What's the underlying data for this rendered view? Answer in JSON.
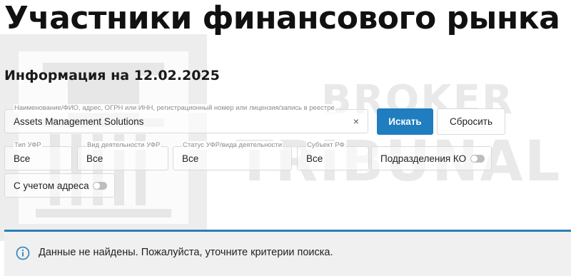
{
  "page_title": "Участники финансового рынка",
  "info_date": "Информация на 12.02.2025",
  "watermark": {
    "line1": "BROKER",
    "line2": "TRIBUNAL"
  },
  "search": {
    "label": "Наименование/ФИО, адрес, ОГРН или ИНН, регистрационный номер или лицензия/запись в реестре",
    "value": "Assets Management Solutions",
    "clear_icon": "×"
  },
  "buttons": {
    "search": "Искать",
    "reset": "Сбросить"
  },
  "filters": [
    {
      "label": "Тип УФР",
      "value": "Все"
    },
    {
      "label": "Вид деятельности УФР",
      "value": "Все"
    },
    {
      "label": "Статус УФР/вида деятельности",
      "value": "Все"
    },
    {
      "label": "Субъект РФ",
      "value": "Все"
    }
  ],
  "toggles": {
    "ko_branches": {
      "label": "Подразделения КО",
      "on": false
    },
    "with_address": {
      "label": "С учетом адреса",
      "on": false
    }
  },
  "notice": {
    "text": "Данные не найдены. Пожалуйста, уточните критерии поиска.",
    "icon": "info-icon"
  },
  "colors": {
    "accent": "#1f7dc0",
    "divider": "#2a7fba",
    "notice_bg": "#f0f0f0"
  }
}
